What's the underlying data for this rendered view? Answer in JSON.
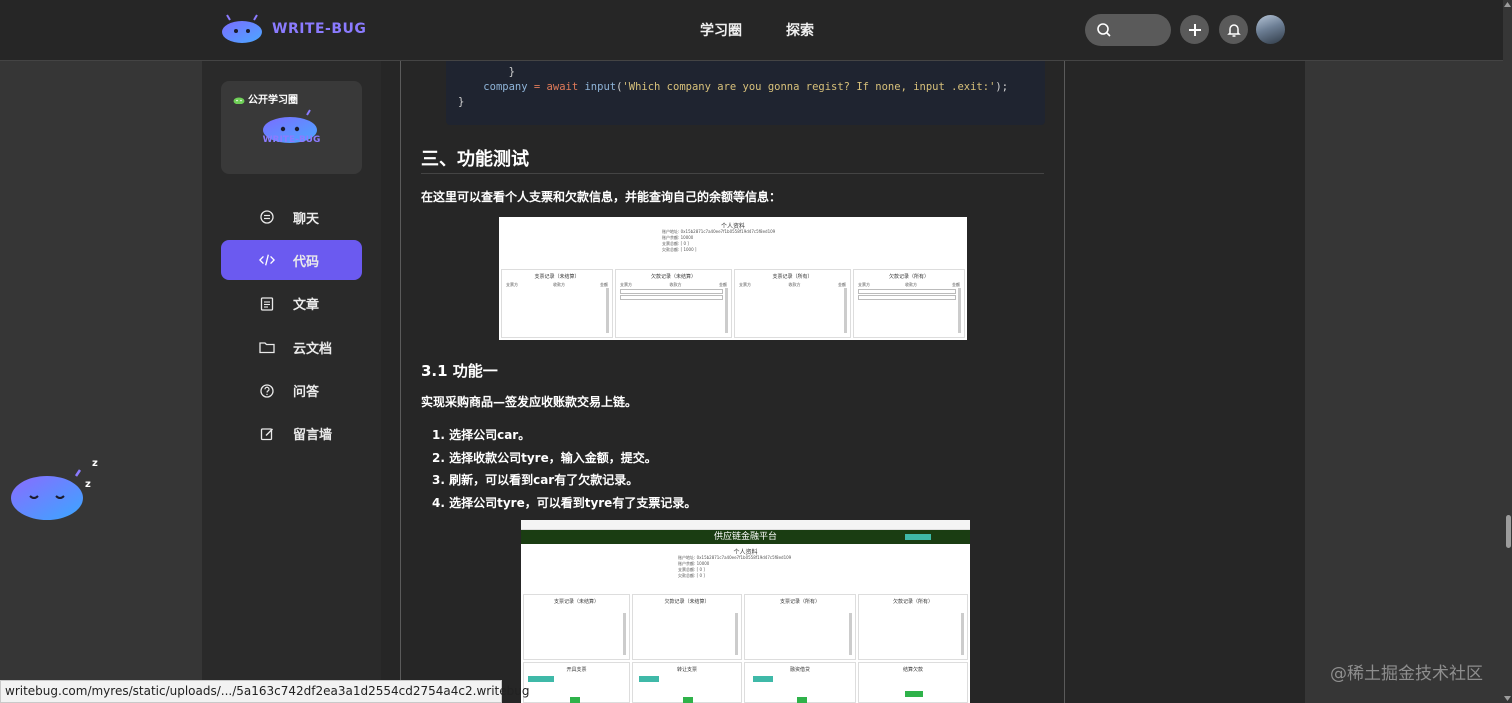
{
  "header": {
    "brand": "WRITE-BUG",
    "nav": [
      "学习圈",
      "探索"
    ],
    "search_icon": "search-icon",
    "add_icon": "plus-icon",
    "notify_icon": "bell-icon"
  },
  "sidebar": {
    "card": {
      "badge": "公开学习圈",
      "brand": "WRITE-BUG"
    },
    "items": [
      {
        "label": "聊天",
        "icon": "chat-icon"
      },
      {
        "label": "代码",
        "icon": "code-icon",
        "active": true
      },
      {
        "label": "文章",
        "icon": "article-icon"
      },
      {
        "label": "云文档",
        "icon": "folder-icon"
      },
      {
        "label": "问答",
        "icon": "question-icon"
      },
      {
        "label": "留言墙",
        "icon": "edit-icon"
      }
    ]
  },
  "article": {
    "code_lines": [
      "    }",
      "    company = await input('Which company are you gonna regist? If none, input .exit:');",
      "}"
    ],
    "h2": "三、功能测试",
    "p1": "在这里可以查看个人支票和欠款信息，并能查询自己的余额等信息：",
    "img1": {
      "title": "个人资料",
      "info": [
        "账户地址: 0x15b2871c7a40ee7f1b0558f19d47c5f8ed109",
        "账户余额: 10000",
        "支票总额: [ 0 ]",
        "欠款总额: [ 1000 ]"
      ],
      "panels": [
        "支票记录（未结算）",
        "欠款记录（未结算）",
        "支票记录（所有）",
        "欠款记录（所有）"
      ],
      "cols": [
        "支票方",
        "收款方",
        "金额"
      ]
    },
    "h3": "3.1 功能一",
    "p2": "实现采购商品—签发应收账款交易上链。",
    "steps": [
      "1. 选择公司car。",
      "2. 选择收款公司tyre，输入金额，提交。",
      "3. 刷新，可以看到car有了欠款记录。",
      "4. 选择公司tyre，可以看到tyre有了支票记录。"
    ],
    "img2": {
      "banner": "供应链金融平台",
      "title": "个人资料",
      "info": [
        "账户地址: 0x15b2871c7a40ee7f1b0558f19d47c5f8ed109",
        "账户余额: 10000",
        "支票总额: [ 0 ]",
        "欠款总额: [ 0 ]"
      ],
      "panels": [
        "支票记录（未结算）",
        "欠款记录（未结算）",
        "支票记录（所有）",
        "欠款记录（所有）"
      ],
      "actions": [
        "开具支票",
        "转让支票",
        "融资借贷",
        "结算欠款"
      ]
    }
  },
  "status_url": "writebug.com/myres/static/uploads/.../5a163c742df2ea3a1d2554cd2754a4c2.writebug",
  "watermark": "@稀土掘金技术社区",
  "colors": {
    "accent": "#6b5af0",
    "brand_text": "#8b7bff",
    "header_bg": "#262626"
  }
}
